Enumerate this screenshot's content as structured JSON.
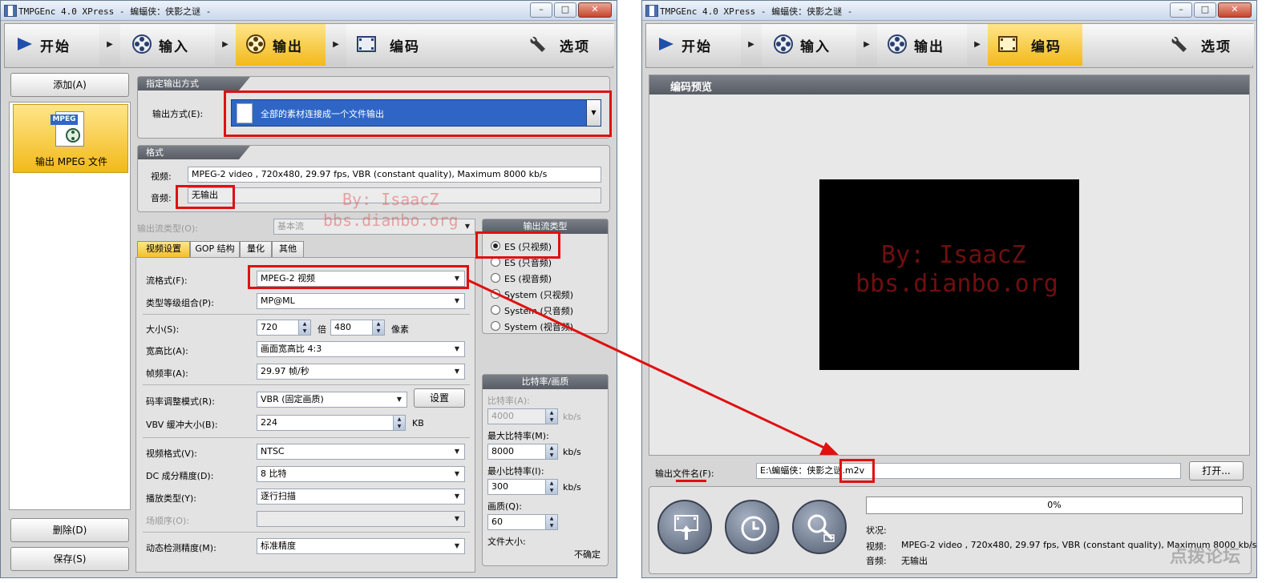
{
  "left_window": {
    "title": "TMPGEnc 4.0 XPress - 蝙蝠侠：侠影之谜 -",
    "toolbar": {
      "start": "开始",
      "input": "输入",
      "output": "输出",
      "encode": "编码",
      "options": "选项"
    },
    "sidebar": {
      "add_button": "添加(A)",
      "item_badge": "MPEG",
      "item_label": "输出 MPEG 文件",
      "delete_button": "删除(D)",
      "save_button": "保存(S)"
    },
    "output_method": {
      "header": "指定输出方式",
      "label": "输出方式(E):",
      "value": "全部的素材连接成一个文件输出"
    },
    "format": {
      "header": "格式",
      "video_label": "视频:",
      "video_value": "MPEG-2 video , 720x480, 29.97 fps, VBR (constant quality), Maximum 8000 kb/s",
      "audio_label": "音频:",
      "audio_value": "无输出"
    },
    "stream_type": {
      "label": "输出流类型(O):",
      "value": "基本流"
    },
    "tabs": [
      "视频设置",
      "GOP 结构",
      "量化",
      "其他"
    ],
    "video_settings": {
      "stream_format_label": "流格式(F):",
      "stream_format_value": "MPEG-2 视频",
      "profile_label": "类型等级组合(P):",
      "profile_value": "MP@ML",
      "size_label": "大小(S):",
      "width": "720",
      "times": "倍",
      "height": "480",
      "pixels": "像素",
      "aspect_label": "宽高比(A):",
      "aspect_value": "画面宽高比 4:3",
      "framerate_label": "帧频率(A):",
      "framerate_value": "29.97 帧/秒",
      "ratecontrol_label": "码率调整模式(R):",
      "ratecontrol_value": "VBR (固定画质)",
      "settings_button": "设置",
      "vbv_label": "VBV 缓冲大小(B):",
      "vbv_value": "224",
      "vbv_unit": "KB",
      "videoformat_label": "视频格式(V):",
      "videoformat_value": "NTSC",
      "dc_label": "DC 成分精度(D):",
      "dc_value": "8 比特",
      "scan_label": "播放类型(Y):",
      "scan_value": "逐行扫描",
      "fieldorder_label": "场顺序(O):",
      "fieldorder_value": "",
      "motion_label": "动态检测精度(M):",
      "motion_value": "标准精度"
    },
    "stream_panel": {
      "header": "输出流类型",
      "options": [
        "ES (只视频)",
        "ES (只音频)",
        "ES (视音频)",
        "System (只视频)",
        "System (只音频)",
        "System (视音频)"
      ],
      "selected_index": 0
    },
    "bitrate_panel": {
      "header": "比特率/画质",
      "bitrate_label": "比特率(A):",
      "bitrate_value": "4000",
      "max_label": "最大比特率(M):",
      "max_value": "8000",
      "min_label": "最小比特率(I):",
      "min_value": "300",
      "quality_label": "画质(Q):",
      "quality_value": "60",
      "unit": "kb/s",
      "filesize_label": "文件大小:",
      "filesize_value": "不确定"
    }
  },
  "right_window": {
    "title": "TMPGEnc 4.0 XPress - 蝙蝠侠：侠影之谜 -",
    "toolbar": {
      "start": "开始",
      "input": "输入",
      "output": "输出",
      "encode": "编码",
      "options": "选项"
    },
    "preview_header": "编码预览",
    "output_file_label": "输出文件名(F):",
    "output_file_value": "E:\\蝙蝠侠：侠影之谜.m2v",
    "browse_button": "打开...",
    "progress": 0,
    "progress_text": "0%",
    "status_label": "状况:",
    "video_label": "视频:",
    "video_value": "MPEG-2 video , 720x480, 29.97 fps, VBR (constant quality), Maximum 8000 kb/s",
    "audio_label": "音频:",
    "audio_value": "无输出"
  },
  "watermarks": {
    "line1": "By: IsaacZ",
    "line2": "bbs.dianbo.org",
    "corner": "点拨论坛"
  },
  "colors": {
    "accent_red": "#e01010",
    "active_tab": "#f2b91a",
    "select_blue": "#2f66c6"
  }
}
